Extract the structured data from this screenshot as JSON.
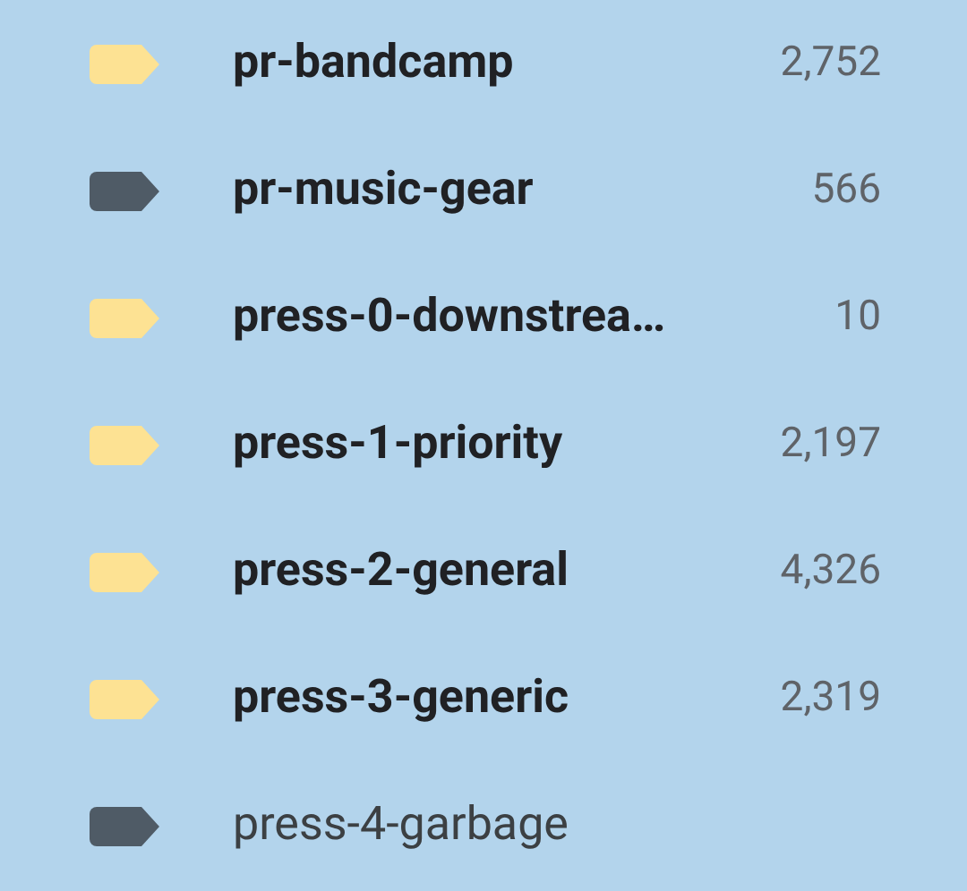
{
  "labels": [
    {
      "name": "pr-bandcamp",
      "count": "2,752",
      "color": "#fde293",
      "unread": true
    },
    {
      "name": "pr-music-gear",
      "count": "566",
      "color": "#4f5b66",
      "unread": true
    },
    {
      "name": "press-0-downstrea…",
      "count": "10",
      "color": "#fde293",
      "unread": true
    },
    {
      "name": "press-1-priority",
      "count": "2,197",
      "color": "#fde293",
      "unread": true
    },
    {
      "name": "press-2-general",
      "count": "4,326",
      "color": "#fde293",
      "unread": true
    },
    {
      "name": "press-3-generic",
      "count": "2,319",
      "color": "#fde293",
      "unread": true
    },
    {
      "name": "press-4-garbage",
      "color": "#4f5b66",
      "unread": false
    }
  ]
}
